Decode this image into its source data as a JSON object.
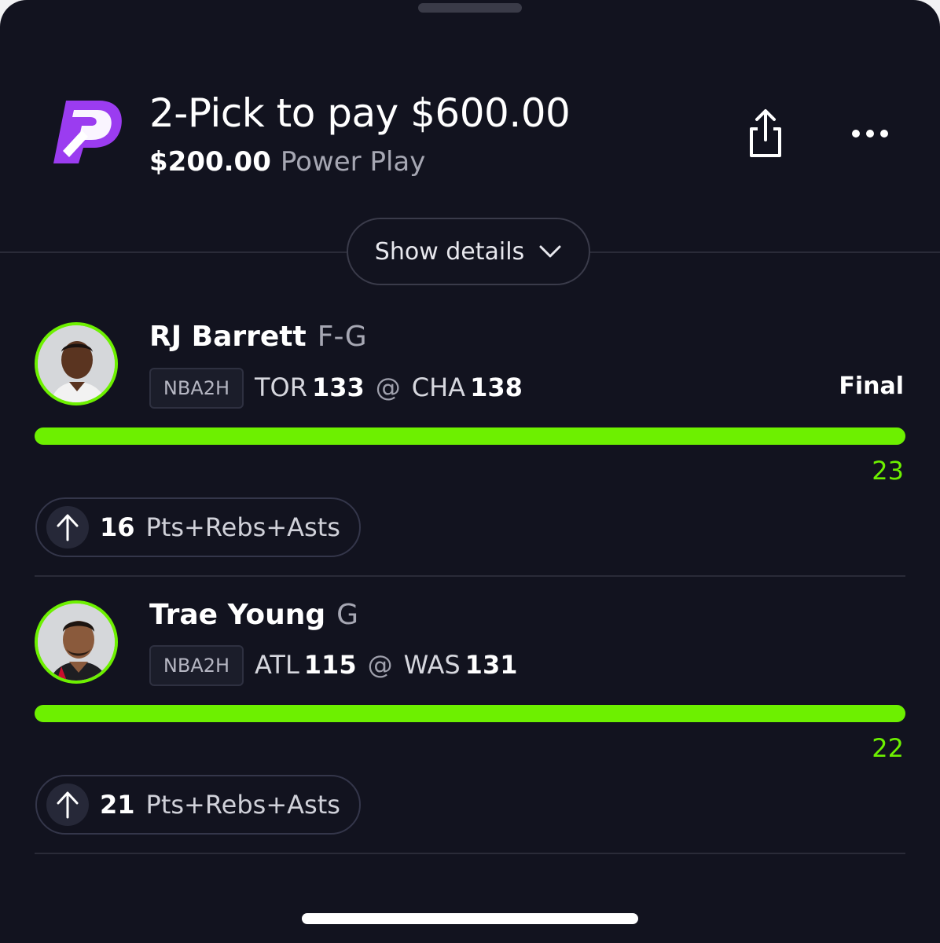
{
  "header": {
    "title": "2-Pick to pay $600.00",
    "entry_amount": "$200.00",
    "play_type": "Power Play"
  },
  "details_button": {
    "label": "Show details"
  },
  "picks": [
    {
      "name": "RJ Barrett",
      "position": "F-G",
      "league": "NBA2H",
      "away_team": "TOR",
      "away_score": "133",
      "at": "@",
      "home_team": "CHA",
      "home_score": "138",
      "status": "Final",
      "actual": "23",
      "line": "16",
      "stat": "Pts+Rebs+Asts",
      "direction": "over",
      "progress": 1.0
    },
    {
      "name": "Trae Young",
      "position": "G",
      "league": "NBA2H",
      "away_team": "ATL",
      "away_score": "115",
      "at": "@",
      "home_team": "WAS",
      "home_score": "131",
      "status": "",
      "actual": "22",
      "line": "21",
      "stat": "Pts+Rebs+Asts",
      "direction": "over",
      "progress": 1.0
    }
  ],
  "colors": {
    "background": "#12131f",
    "accent": "#6df000",
    "brand": "#9b3cf0"
  },
  "icons": {
    "logo": "prizepicks-logo",
    "share": "share-icon",
    "more": "more-icon",
    "expand": "chevron-down-icon",
    "direction": "arrow-up-icon"
  }
}
